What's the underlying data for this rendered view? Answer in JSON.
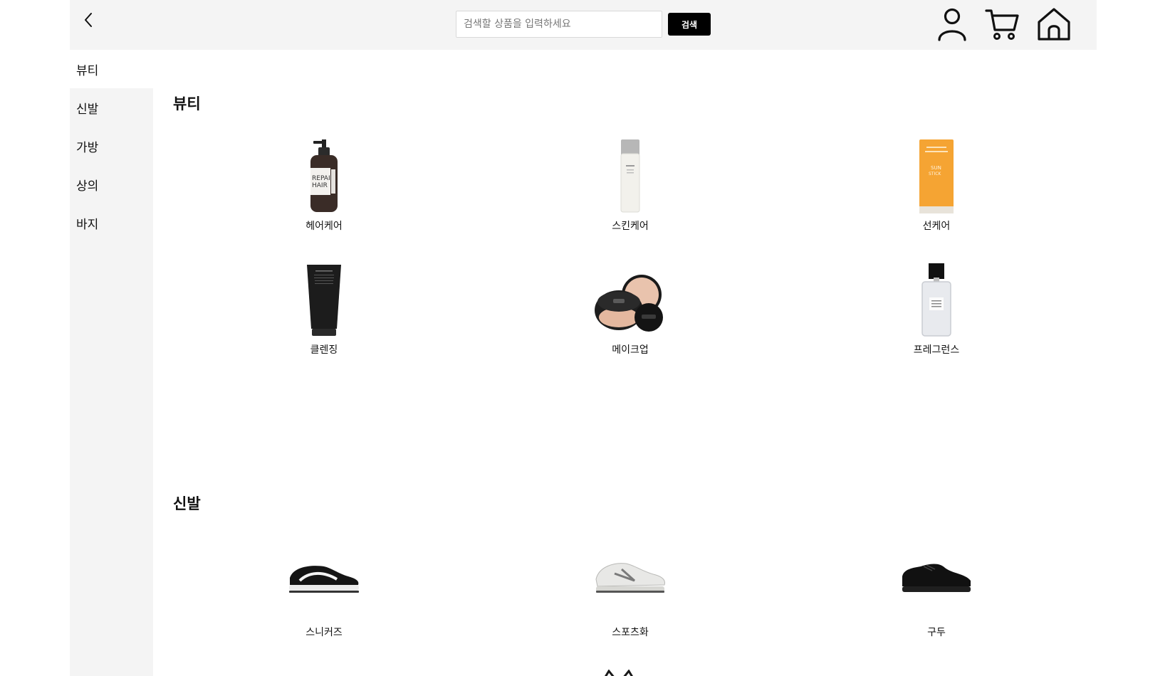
{
  "header": {
    "search_placeholder": "검색할 상품을 입력하세요",
    "search_value": "",
    "search_button": "검색",
    "icons": [
      "back-arrow-icon",
      "user-icon",
      "cart-icon",
      "home-icon"
    ]
  },
  "sidebar": {
    "items": [
      {
        "label": "뷰티",
        "active": true
      },
      {
        "label": "신발",
        "active": false
      },
      {
        "label": "가방",
        "active": false
      },
      {
        "label": "상의",
        "active": false
      },
      {
        "label": "바지",
        "active": false
      }
    ]
  },
  "sections": [
    {
      "title": "뷰티",
      "products": [
        {
          "label": "헤어케어",
          "image": "shampoo-bottle"
        },
        {
          "label": "스킨케어",
          "image": "toner-bottle"
        },
        {
          "label": "선케어",
          "image": "sun-stick"
        },
        {
          "label": "클렌징",
          "image": "cleansing-tube"
        },
        {
          "label": "메이크업",
          "image": "cushion-compact"
        },
        {
          "label": "프레그런스",
          "image": "perfume-bottle"
        }
      ]
    },
    {
      "title": "신발",
      "products": [
        {
          "label": "스니커즈",
          "image": "sneaker"
        },
        {
          "label": "스포츠화",
          "image": "sports-shoe"
        },
        {
          "label": "구두",
          "image": "dress-shoe"
        }
      ]
    }
  ],
  "product_image_texts": {
    "shampoo_label_line1": "REPAIR",
    "shampoo_label_line2": "HAIR",
    "sunstick_label_line1": "SUN",
    "sunstick_label_line2": "STICK"
  },
  "colors": {
    "header_bg": "#f4f4f4",
    "sidebar_bg": "#f4f4f4",
    "search_button_bg": "#000000",
    "accent_orange": "#f5a433"
  }
}
